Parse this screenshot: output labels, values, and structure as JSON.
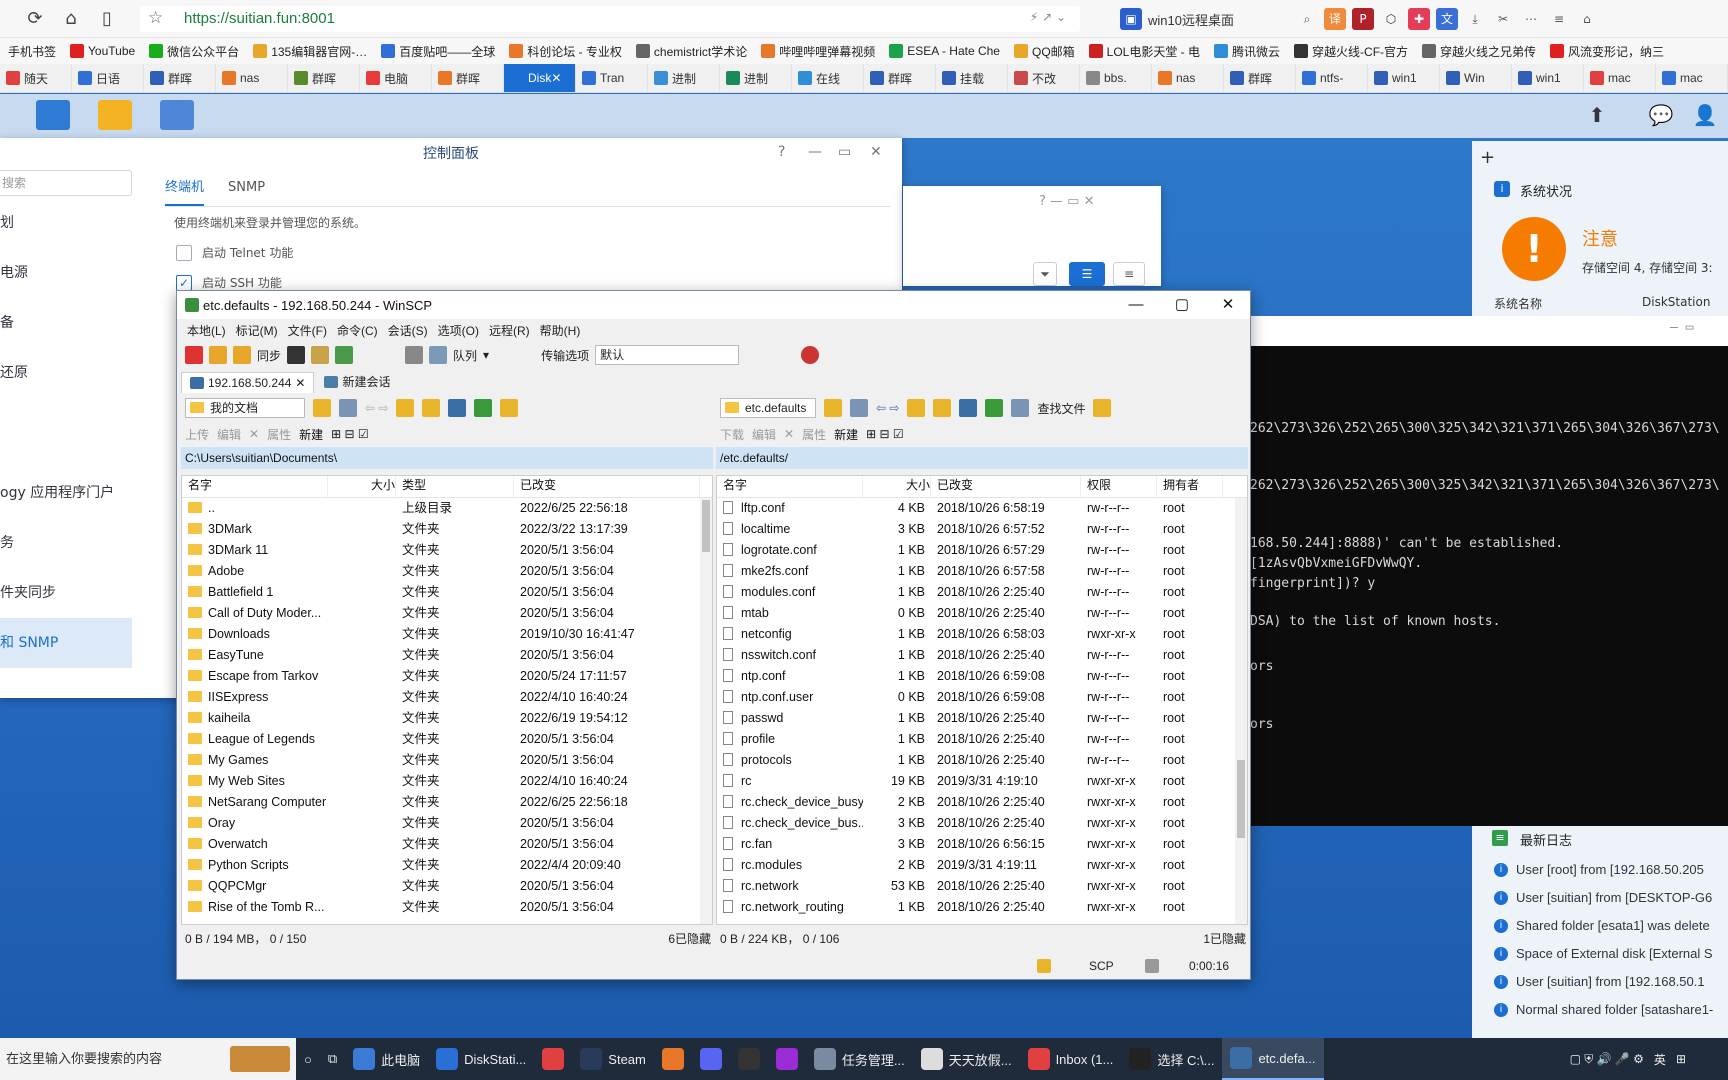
{
  "browser": {
    "url": "https://suitian.fun:8001",
    "site_label": "win10远程桌面",
    "bookmarks": [
      "手机书签",
      "YouTube",
      "微信公众平台",
      "135编辑器官网-…",
      "百度贴吧——全球",
      "科创论坛 - 专业权",
      "chemistrict学术论",
      "哔哩哔哩弹幕视频",
      "ESEA - Hate Che",
      "QQ邮箱",
      "LOL电影天堂 - 电",
      "腾讯微云",
      "穿越火线-CF-官方",
      "穿越火线之兄弟传",
      "风流变形记，纳三"
    ],
    "tabs": [
      "随天",
      "日语",
      "群晖",
      "nas",
      "群晖",
      "电脑",
      "群晖",
      "Disk",
      "Tran",
      "进制",
      "进制",
      "在线",
      "群晖",
      "挂载",
      "不改",
      "bbs.",
      "nas",
      "群晖",
      "ntfs-",
      "win1",
      "Win",
      "win1",
      "mac",
      "mac"
    ],
    "active_tab_index": 7
  },
  "control_panel": {
    "title": "控制面板",
    "search_placeholder": "搜索",
    "sidebar": [
      "划",
      "电源",
      "备",
      "还原",
      "ogy 应用程序门户",
      "务",
      "件夹同步",
      "和 SNMP"
    ],
    "active_sidebar_index": 7,
    "tabs": [
      "终端机",
      "SNMP"
    ],
    "description": "使用终端机来登录并管理您的系统。",
    "telnet_label": "启动 Telnet 功能",
    "ssh_label": "启动 SSH 功能"
  },
  "widgets": {
    "system_status_title": "系统状况",
    "status_text": "注意",
    "status_detail": "存储空间 4, 存储空间 3:",
    "system_name_label": "系统名称",
    "system_name_value": "DiskStation",
    "log_title": "最新日志",
    "logs": [
      "User [root] from [192.168.50.205",
      "User [suitian] from [DESKTOP-G6",
      "Shared folder [esata1] was delete",
      "Space of External disk [External S",
      "User [suitian] from [192.168.50.1",
      "Normal shared folder [satashare1-"
    ]
  },
  "terminal": {
    "lines": [
      "262\\273\\326\\252\\265\\300\\325\\342\\321\\371\\265\\304\\326\\367\\273\\",
      "262\\273\\326\\252\\265\\300\\325\\342\\321\\371\\265\\304\\326\\367\\273\\",
      "168.50.244]:8888)' can't be established.",
      "[1zAsvQbVxmeiGFDvWwQY.",
      "fingerprint])? y",
      "DSA) to the list of known hosts.",
      "ors",
      "ors"
    ]
  },
  "winscp": {
    "title": "etc.defaults - 192.168.50.244 - WinSCP",
    "menu": [
      "本地(L)",
      "标记(M)",
      "文件(F)",
      "命令(C)",
      "会话(S)",
      "选项(O)",
      "远程(R)",
      "帮助(H)"
    ],
    "toolbar": {
      "sync_label": "同步",
      "queue_label": "队列",
      "transfer_label": "传输选项",
      "transfer_value": "默认"
    },
    "session_tab": "192.168.50.244",
    "new_session": "新建会话",
    "left": {
      "location": "我的文档",
      "upload": "上传",
      "edit": "编辑",
      "props": "属性",
      "new": "新建",
      "path": "C:\\Users\\suitian\\Documents\\",
      "columns": [
        "名字",
        "大小",
        "类型",
        "已改变"
      ],
      "rows": [
        [
          "..",
          "",
          "上级目录",
          "2022/6/25  22:56:18"
        ],
        [
          "3DMark",
          "",
          "文件夹",
          "2022/3/22  13:17:39"
        ],
        [
          "3DMark 11",
          "",
          "文件夹",
          "2020/5/1   3:56:04"
        ],
        [
          "Adobe",
          "",
          "文件夹",
          "2020/5/1   3:56:04"
        ],
        [
          "Battlefield 1",
          "",
          "文件夹",
          "2020/5/1   3:56:04"
        ],
        [
          "Call of Duty Moder...",
          "",
          "文件夹",
          "2020/5/1   3:56:04"
        ],
        [
          "Downloads",
          "",
          "文件夹",
          "2019/10/30  16:41:47"
        ],
        [
          "EasyTune",
          "",
          "文件夹",
          "2020/5/1   3:56:04"
        ],
        [
          "Escape from Tarkov",
          "",
          "文件夹",
          "2020/5/24  17:11:57"
        ],
        [
          "IISExpress",
          "",
          "文件夹",
          "2022/4/10  16:40:24"
        ],
        [
          "kaiheila",
          "",
          "文件夹",
          "2022/6/19  19:54:12"
        ],
        [
          "League of Legends",
          "",
          "文件夹",
          "2020/5/1   3:56:04"
        ],
        [
          "My Games",
          "",
          "文件夹",
          "2020/5/1   3:56:04"
        ],
        [
          "My Web Sites",
          "",
          "文件夹",
          "2022/4/10  16:40:24"
        ],
        [
          "NetSarang Computer",
          "",
          "文件夹",
          "2022/6/25  22:56:18"
        ],
        [
          "Oray",
          "",
          "文件夹",
          "2020/5/1   3:56:04"
        ],
        [
          "Overwatch",
          "",
          "文件夹",
          "2020/5/1   3:56:04"
        ],
        [
          "Python Scripts",
          "",
          "文件夹",
          "2022/4/4  20:09:40"
        ],
        [
          "QQPCMgr",
          "",
          "文件夹",
          "2020/5/1   3:56:04"
        ],
        [
          "Rise of the Tomb R...",
          "",
          "文件夹",
          "2020/5/1   3:56:04"
        ]
      ],
      "status": "0 B / 194 MB，  0 / 150",
      "hidden": "6已隐藏"
    },
    "right": {
      "location": "etc.defaults",
      "download": "下载",
      "edit": "编辑",
      "props": "属性",
      "new": "新建",
      "find": "查找文件",
      "path": "/etc.defaults/",
      "columns": [
        "名字",
        "大小",
        "已改变",
        "权限",
        "拥有者"
      ],
      "rows": [
        [
          "lftp.conf",
          "4 KB",
          "2018/10/26 6:58:19",
          "rw-r--r--",
          "root"
        ],
        [
          "localtime",
          "3 KB",
          "2018/10/26 6:57:52",
          "rw-r--r--",
          "root"
        ],
        [
          "logrotate.conf",
          "1 KB",
          "2018/10/26 6:57:29",
          "rw-r--r--",
          "root"
        ],
        [
          "mke2fs.conf",
          "1 KB",
          "2018/10/26 6:57:58",
          "rw-r--r--",
          "root"
        ],
        [
          "modules.conf",
          "1 KB",
          "2018/10/26 2:25:40",
          "rw-r--r--",
          "root"
        ],
        [
          "mtab",
          "0 KB",
          "2018/10/26 2:25:40",
          "rw-r--r--",
          "root"
        ],
        [
          "netconfig",
          "1 KB",
          "2018/10/26 6:58:03",
          "rwxr-xr-x",
          "root"
        ],
        [
          "nsswitch.conf",
          "1 KB",
          "2018/10/26 2:25:40",
          "rw-r--r--",
          "root"
        ],
        [
          "ntp.conf",
          "1 KB",
          "2018/10/26 6:59:08",
          "rw-r--r--",
          "root"
        ],
        [
          "ntp.conf.user",
          "0 KB",
          "2018/10/26 6:59:08",
          "rw-r--r--",
          "root"
        ],
        [
          "passwd",
          "1 KB",
          "2018/10/26 2:25:40",
          "rw-r--r--",
          "root"
        ],
        [
          "profile",
          "1 KB",
          "2018/10/26 2:25:40",
          "rw-r--r--",
          "root"
        ],
        [
          "protocols",
          "1 KB",
          "2018/10/26 2:25:40",
          "rw-r--r--",
          "root"
        ],
        [
          "rc",
          "19 KB",
          "2019/3/31 4:19:10",
          "rwxr-xr-x",
          "root"
        ],
        [
          "rc.check_device_busy",
          "2 KB",
          "2018/10/26 2:25:40",
          "rwxr-xr-x",
          "root"
        ],
        [
          "rc.check_device_bus...",
          "3 KB",
          "2018/10/26 2:25:40",
          "rwxr-xr-x",
          "root"
        ],
        [
          "rc.fan",
          "3 KB",
          "2018/10/26 6:56:15",
          "rwxr-xr-x",
          "root"
        ],
        [
          "rc.modules",
          "2 KB",
          "2019/3/31 4:19:11",
          "rwxr-xr-x",
          "root"
        ],
        [
          "rc.network",
          "53 KB",
          "2018/10/26 2:25:40",
          "rwxr-xr-x",
          "root"
        ],
        [
          "rc.network_routing",
          "1 KB",
          "2018/10/26 2:25:40",
          "rwxr-xr-x",
          "root"
        ]
      ],
      "status": "0 B / 224 KB，  0 / 106",
      "hidden": "1已隐藏"
    },
    "protocol": "SCP",
    "timer": "0:00:16"
  },
  "taskbar": {
    "search_placeholder": "在这里输入你要搜索的内容",
    "apps": [
      "此电脑",
      "DiskStati...",
      "",
      "Steam",
      "",
      "",
      "",
      "",
      "任务管理...",
      "天天放假...",
      "Inbox (1...",
      "选择 C:\\...",
      "etc.defa..."
    ],
    "ime": "英"
  }
}
